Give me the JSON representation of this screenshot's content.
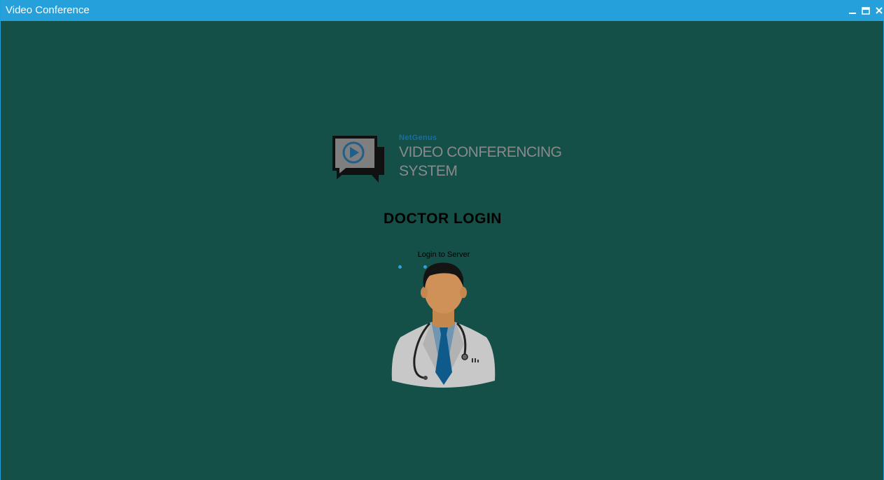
{
  "window": {
    "title": "Video Conference",
    "controls": [
      "minimize-icon",
      "maximize-icon",
      "close-icon"
    ]
  },
  "logo": {
    "small_text": "NetGenus",
    "line1": "VIDEO CONFERENCING",
    "line2": "SYSTEM",
    "icon": "chat-bubble-play-icon"
  },
  "login": {
    "heading": "DOCTOR LOGIN",
    "status": "Login to Server",
    "avatar": "doctor-avatar"
  },
  "colors": {
    "titlebar": "#25a0da",
    "background": "#144f48",
    "accent": "#2aa3e0",
    "logo_text": "#8a8a8a"
  }
}
